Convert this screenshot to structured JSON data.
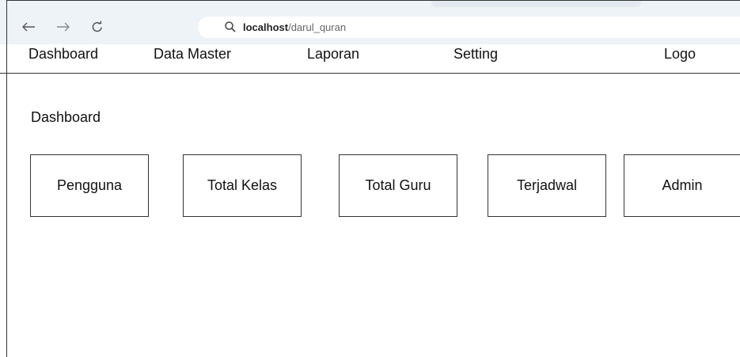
{
  "browser": {
    "url_host": "localhost",
    "url_path": "/darul_quran",
    "icons": {
      "back": "arrow-left-icon",
      "forward": "arrow-right-icon",
      "reload": "reload-icon",
      "search": "search-icon"
    }
  },
  "menu": {
    "items": [
      {
        "label": "Dashboard"
      },
      {
        "label": "Data Master"
      },
      {
        "label": "Laporan"
      },
      {
        "label": "Setting"
      }
    ],
    "logo": "Logo"
  },
  "main": {
    "title": "Dashboard",
    "cards": [
      {
        "label": "Pengguna"
      },
      {
        "label": "Total Kelas"
      },
      {
        "label": "Total Guru"
      },
      {
        "label": "Terjadwal"
      },
      {
        "label": "Admin"
      }
    ]
  },
  "colors": {
    "chrome_background": "#eef3f8",
    "border": "#333333",
    "text": "#111111"
  }
}
